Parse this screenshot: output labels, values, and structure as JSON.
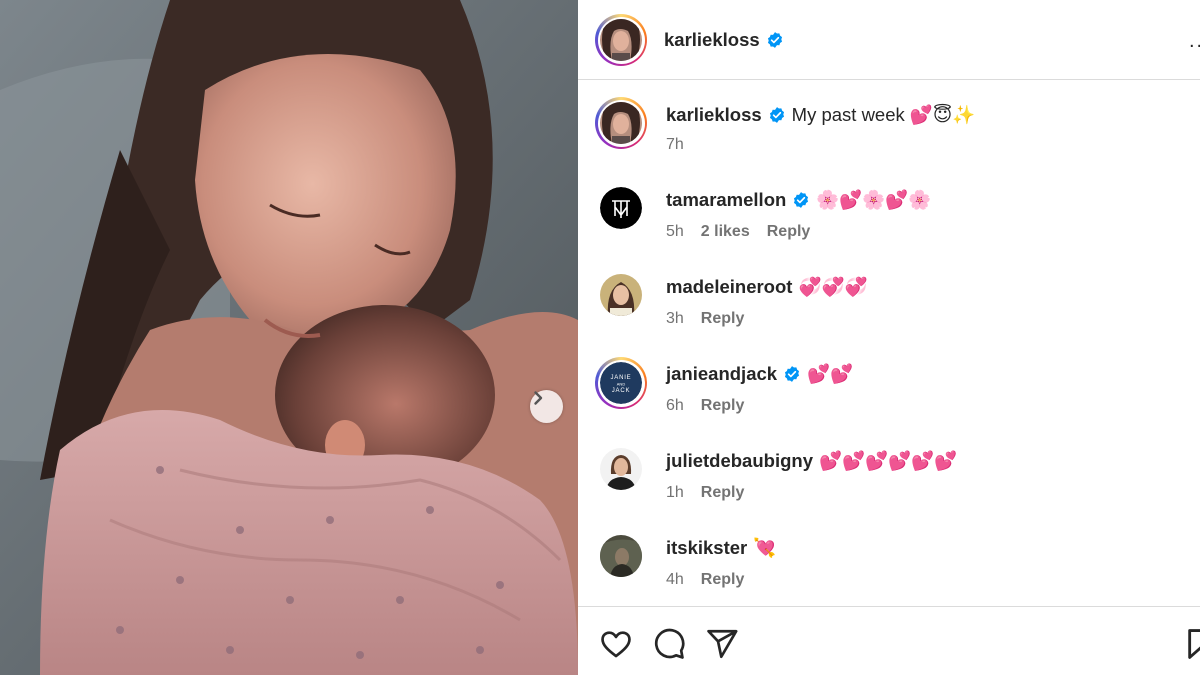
{
  "post": {
    "author": "karliekloss",
    "carousel_icon": "chevron-right-icon"
  },
  "header": {
    "username": "karliekloss",
    "verified_icon": "verified-badge-icon",
    "more_icon": "more-options-icon",
    "more_label": "..."
  },
  "caption": {
    "username": "karliekloss",
    "text": "My past week 💕😇✨",
    "time": "7h"
  },
  "comments": [
    {
      "username": "tamaramellon",
      "verified": true,
      "text": "🌸💕🌸💕🌸",
      "time": "5h",
      "likes": "2 likes",
      "reply": "Reply"
    },
    {
      "username": "madeleineroot",
      "verified": false,
      "text": "💞💞💞",
      "time": "3h",
      "likes": "",
      "reply": "Reply"
    },
    {
      "username": "janieandjack",
      "verified": true,
      "text": "💕💕",
      "time": "6h",
      "likes": "",
      "reply": "Reply",
      "avatar_text": "JANIE AND JACK"
    },
    {
      "username": "julietdebaubigny",
      "verified": false,
      "text": "💕💕💕💕💕💕",
      "time": "1h",
      "likes": "",
      "reply": "Reply"
    },
    {
      "username": "itskikster",
      "verified": false,
      "text": "💘",
      "time": "4h",
      "likes": "",
      "reply": "Reply"
    }
  ],
  "actions": {
    "like_icon": "heart-icon",
    "comment_icon": "comment-icon",
    "share_icon": "share-icon",
    "save_icon": "bookmark-icon"
  },
  "colors": {
    "verified_blue": "#0095f6",
    "text": "#262626",
    "secondary_text": "#737373",
    "border": "#dbdbdb",
    "janieandjack_navy": "#1f3a5f"
  }
}
